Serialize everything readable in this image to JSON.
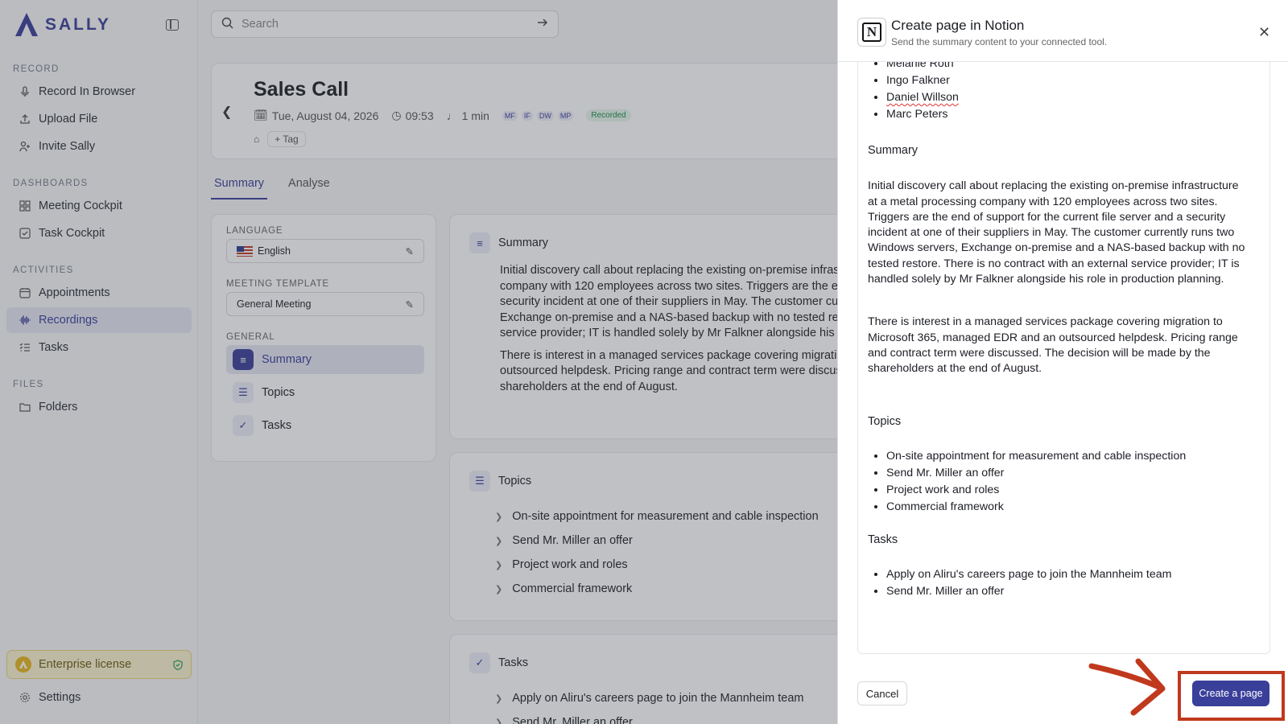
{
  "app": {
    "brand": "SALLY",
    "search_placeholder": "Search",
    "colors": {
      "accent": "#3a3f9a",
      "highlight": "#c0391d",
      "license_bg": "#fbf3cf"
    }
  },
  "sidebar": {
    "sections": [
      {
        "label": "RECORD",
        "items": [
          {
            "label": "Record In Browser",
            "icon": "microphone-icon"
          },
          {
            "label": "Upload File",
            "icon": "upload-icon"
          },
          {
            "label": "Invite Sally",
            "icon": "add-user-icon"
          }
        ]
      },
      {
        "label": "DASHBOARDS",
        "items": [
          {
            "label": "Meeting Cockpit",
            "icon": "grid-icon"
          },
          {
            "label": "Task Cockpit",
            "icon": "checkbox-icon"
          }
        ]
      },
      {
        "label": "ACTIVITIES",
        "items": [
          {
            "label": "Appointments",
            "icon": "calendar-icon"
          },
          {
            "label": "Recordings",
            "icon": "waveform-icon",
            "active": true
          },
          {
            "label": "Tasks",
            "icon": "task-list-icon"
          }
        ]
      },
      {
        "label": "FILES",
        "items": [
          {
            "label": "Folders",
            "icon": "folder-icon"
          }
        ]
      }
    ],
    "license": "Enterprise license",
    "settings": "Settings"
  },
  "meeting": {
    "title": "Sales Call",
    "date": "Tue, August 04, 2026",
    "time": "09:53",
    "duration": "1 min",
    "participants": [
      "MF",
      "IF",
      "DW",
      "MP"
    ],
    "status": "Recorded",
    "tag_label": "Tag"
  },
  "tabs": [
    "Summary",
    "Analyse"
  ],
  "settings_panel": {
    "language_label": "LANGUAGE",
    "language_value": "English",
    "template_label": "MEETING TEMPLATE",
    "template_value": "General Meeting",
    "general_label": "GENERAL",
    "items": [
      "Summary",
      "Topics",
      "Tasks"
    ]
  },
  "main": {
    "summary_title": "Summary",
    "summary_p1": "Initial discovery call about replacing the existing on-premise infras company with 120 employees across two sites. Triggers are the end c a security incident at one of their suppliers in May. The customer cur Exchange on-premise and a NAS-based backup with no tested resto service provider; IT is handled solely by Mr Falkner alongside his role",
    "summary_p2": "There is interest in a managed services package covering migration outsourced helpdesk. Pricing range and contract term were discusse shareholders at the end of August.",
    "topics_title": "Topics",
    "topics": [
      "On-site appointment for measurement and cable inspection",
      "Send Mr. Miller an offer",
      "Project work and roles",
      "Commercial framework"
    ],
    "tasks_title": "Tasks",
    "tasks": [
      "Apply on Aliru's careers page to join the Mannheim team",
      "Send Mr. Miller an offer"
    ]
  },
  "dialog": {
    "title": "Create page in Notion",
    "subtitle": "Send the summary content to your connected tool.",
    "participants": [
      "Melanie Roth",
      "Ingo Falkner",
      "Daniel Willson",
      "Marc Peters"
    ],
    "summary_heading": "Summary",
    "summary_p1": "Initial discovery call about replacing the existing on-premise infrastructure at a metal processing company with 120 employees across two sites. Triggers are the end of support for the current file server and a security incident at one of their suppliers in May. The customer currently runs two Windows servers, Exchange on-premise and a NAS-based backup with no tested restore. There is no contract with an external service provider; IT is handled solely by Mr Falkner alongside his role in production planning.",
    "summary_p2": "There is interest in a managed services package covering migration to Microsoft 365, managed EDR and an outsourced helpdesk. Pricing range and contract term were discussed. The decision will be made by the shareholders at the end of August.",
    "topics_heading": "Topics",
    "topics": [
      "On-site appointment for measurement and cable inspection",
      "Send Mr. Miller an offer",
      "Project work and roles",
      "Commercial framework"
    ],
    "tasks_heading": "Tasks",
    "tasks": [
      "Apply on Aliru's careers page to join the Mannheim team",
      "Send Mr. Miller an offer"
    ],
    "cancel_label": "Cancel",
    "create_label": "Create a page"
  }
}
